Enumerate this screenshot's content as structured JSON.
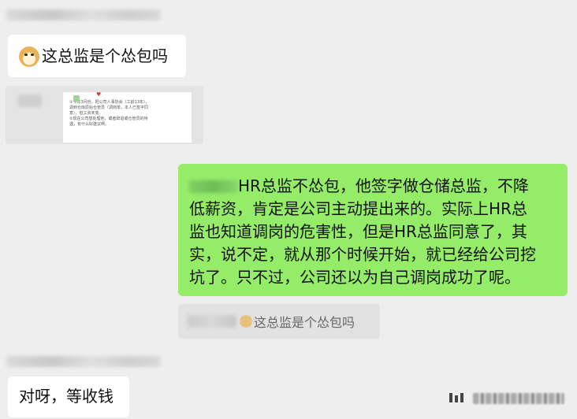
{
  "messages": {
    "msg1_text": "这总监是个怂包吗",
    "msg1_emoji": "doge-emoji",
    "card_lines": [
      "①今年3月份，把公司人事协会（工龄13年），",
      "调到仓库原始仓管员（调岗单，本人已签字同",
      "意），但工资未变。",
      "②现在公司想处理他，或者辞退或仓管员的待",
      "遇，有什么好建议啊。"
    ],
    "msg2_lines": [
      "HR总监不怂包，他签字做仓储总监，不降",
      "低薪资，肯定是公司主动提出来的。实际上HR总",
      "监也知道调岗的危害性，但是HR总监同意了，其",
      "实，说不定，就从那个时候开始，就已经给公司挖",
      "坑了。只不过，公司还以为自己调岗成功了呢。"
    ],
    "quote_text": "这总监是个怂包吗",
    "msg3_text": "对呀，等收钱"
  },
  "colors": {
    "background": "#eeeeee",
    "sent_bubble": "#95ec69",
    "received_bubble": "#ffffff",
    "quote_bg": "#e2e2e2"
  },
  "icons": {
    "card_heart": "♥",
    "watermark": "watermark-icon"
  }
}
